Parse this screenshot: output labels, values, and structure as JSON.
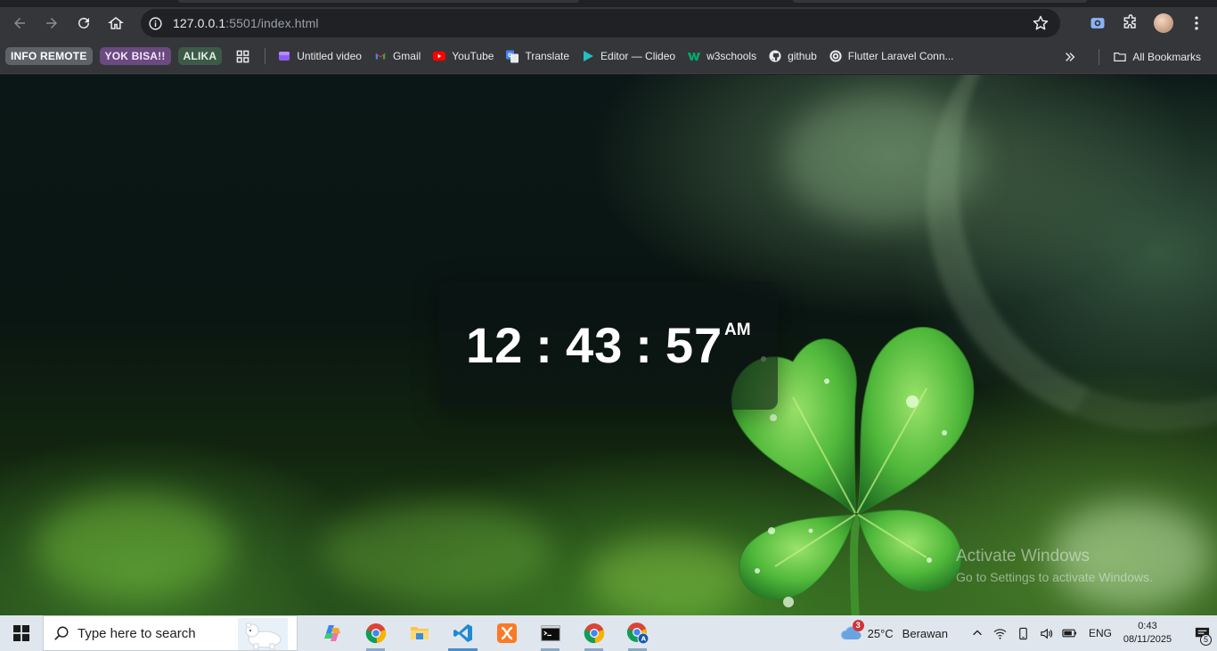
{
  "browser": {
    "url_host": "127.0.0.1",
    "url_rest": ":5501/index.html"
  },
  "bookmarks": {
    "groups": [
      {
        "label": "INFO REMOTE",
        "bg": "#5f6368",
        "fg": "#ffffff"
      },
      {
        "label": "YOK BISA!!",
        "bg": "#6b4a7f",
        "fg": "#f3e6ff"
      },
      {
        "label": "ALIKA",
        "bg": "#3d5a47",
        "fg": "#dff3e4"
      }
    ],
    "items": [
      {
        "label": "Untitled video",
        "icon": "clipchamp-icon"
      },
      {
        "label": "Gmail",
        "icon": "gmail-icon"
      },
      {
        "label": "YouTube",
        "icon": "youtube-icon"
      },
      {
        "label": "Translate",
        "icon": "translate-icon"
      },
      {
        "label": "Editor — Clideo",
        "icon": "clideo-icon"
      },
      {
        "label": "w3schools",
        "icon": "w3schools-icon"
      },
      {
        "label": "github",
        "icon": "github-icon"
      },
      {
        "label": "Flutter Laravel Conn...",
        "icon": "chatgpt-icon"
      }
    ],
    "all_bookmarks": "All Bookmarks"
  },
  "clock": {
    "hours": "12",
    "minutes": "43",
    "seconds": "57",
    "separator": ":",
    "ampm": "AM"
  },
  "watermark": {
    "line1": "Activate Windows",
    "line2": "Go to Settings to activate Windows."
  },
  "taskbar": {
    "search_placeholder": "Type here to search",
    "weather_badge": "3",
    "temperature": "25°C",
    "condition": "Berawan",
    "language": "ENG",
    "time": "0:43",
    "date": "08/11/2025",
    "notification_count": "5",
    "apps": [
      "copilot-icon",
      "chrome-icon",
      "file-explorer-icon",
      "vscode-icon",
      "xampp-icon",
      "terminal-icon",
      "chrome-icon",
      "chrome-profile-icon"
    ]
  },
  "colors": {
    "chrome_bg": "#35363a",
    "omnibox_bg": "#202124",
    "taskbar_bg": "#dfe6ee",
    "clock_text": "#ffffff"
  }
}
